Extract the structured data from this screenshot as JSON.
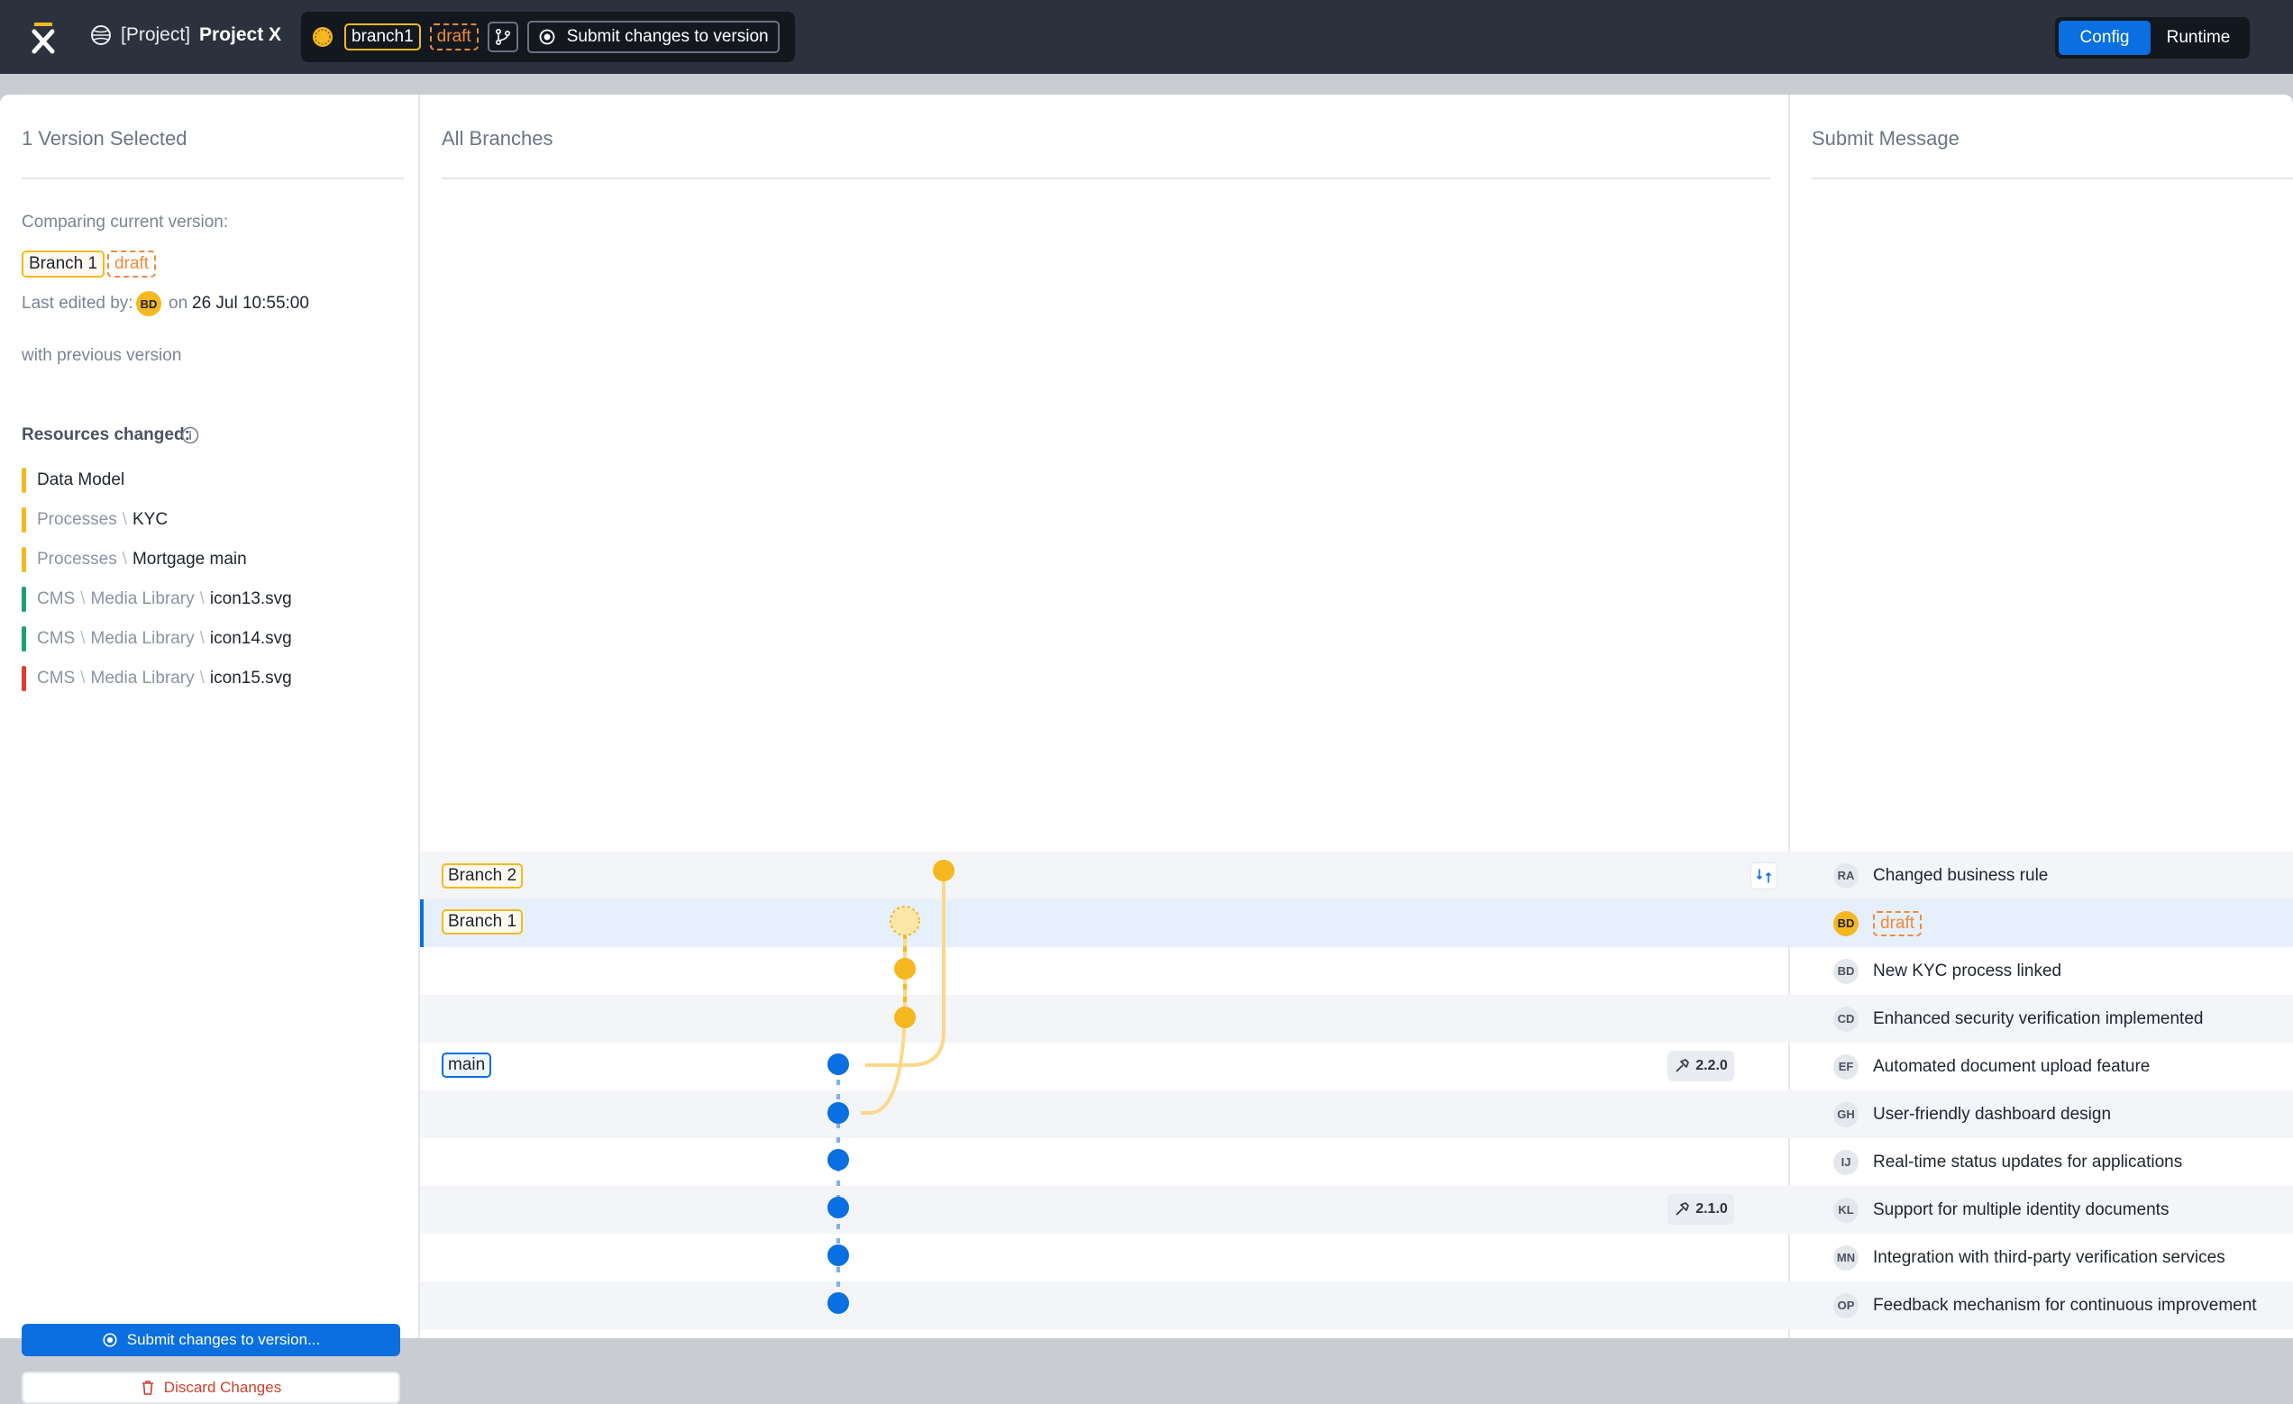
{
  "topbar": {
    "project_prefix": "[Project]",
    "project_name": "Project X",
    "branch": "branch1",
    "status": "draft",
    "submit_label": "Submit changes to version",
    "modes": [
      "Config",
      "Runtime"
    ],
    "active_mode": "Config"
  },
  "left": {
    "title": "1 Version Selected",
    "comparing_label": "Comparing current version:",
    "branch": "Branch 1",
    "status": "draft",
    "last_edited_label": "Last edited by:",
    "editor_initials": "BD",
    "on_label": "on",
    "edited_date": "26 Jul 10:55:00",
    "previous_label": "with previous version",
    "resources_label": "Resources changed:",
    "resources": [
      {
        "path": [],
        "name": "Data Model",
        "color": "#f5b820"
      },
      {
        "path": [
          "Processes"
        ],
        "name": "KYC",
        "color": "#f5b820"
      },
      {
        "path": [
          "Processes"
        ],
        "name": "Mortgage main",
        "color": "#f5b820"
      },
      {
        "path": [
          "CMS",
          "Media Library"
        ],
        "name": "icon13.svg",
        "color": "#1f9e7a"
      },
      {
        "path": [
          "CMS",
          "Media Library"
        ],
        "name": "icon14.svg",
        "color": "#1f9e7a"
      },
      {
        "path": [
          "CMS",
          "Media Library"
        ],
        "name": "icon15.svg",
        "color": "#e23b2e"
      }
    ],
    "submit_button": "Submit changes to version...",
    "discard_button": "Discard Changes"
  },
  "center": {
    "title": "All Branches",
    "branch_labels": {
      "branch2": "Branch 2",
      "branch1": "Branch 1",
      "main": "main"
    },
    "tags": [
      "2.2.0",
      "2.1.0"
    ]
  },
  "right": {
    "title": "Submit Message",
    "messages": [
      {
        "initials": "RA",
        "text": "Changed business rule"
      },
      {
        "initials": "BD",
        "text": "draft"
      },
      {
        "initials": "BD",
        "text": "New KYC process linked"
      },
      {
        "initials": "CD",
        "text": "Enhanced security verification implemented"
      },
      {
        "initials": "EF",
        "text": "Automated document upload feature"
      },
      {
        "initials": "GH",
        "text": "User-friendly dashboard design"
      },
      {
        "initials": "IJ",
        "text": "Real-time status updates for applications"
      },
      {
        "initials": "KL",
        "text": "Support for multiple identity documents"
      },
      {
        "initials": "MN",
        "text": "Integration with third-party verification services"
      },
      {
        "initials": "OP",
        "text": "Feedback mechanism for continuous improvement"
      }
    ]
  },
  "colors": {
    "accent": "#0a6fe0",
    "branch": "#f5b820",
    "draft": "#f08a3c"
  }
}
